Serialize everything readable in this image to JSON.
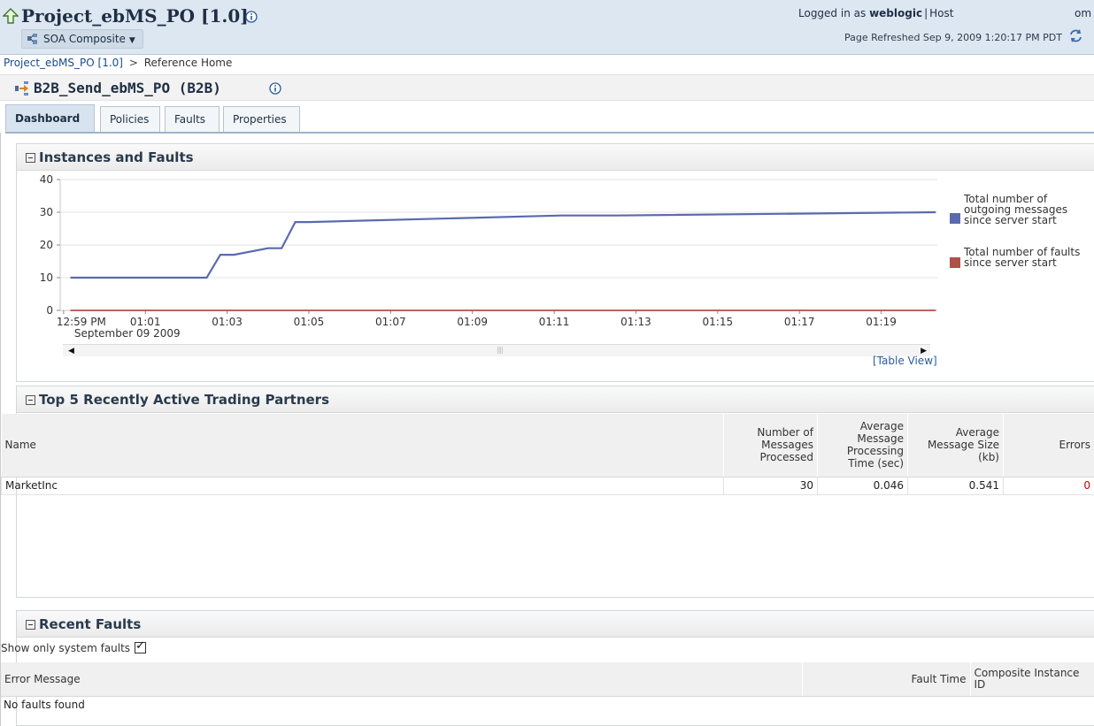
{
  "header": {
    "app_title": "Project_ebMS_PO [1.0]",
    "menu_label": "SOA Composite",
    "logged_in_prefix": "Logged in as",
    "user": "weblogic",
    "separator": "|",
    "host_label": "Host",
    "host_value": "om",
    "refreshed": "Page Refreshed Sep 9, 2009 1:20:17 PM PDT"
  },
  "breadcrumb": {
    "link": "Project_ebMS_PO [1.0]",
    "separator": ">",
    "current": "Reference Home"
  },
  "page": {
    "title": "B2B_Send_ebMS_PO (B2B)"
  },
  "tabs": [
    {
      "label": "Dashboard",
      "active": true
    },
    {
      "label": "Policies",
      "active": false
    },
    {
      "label": "Faults",
      "active": false
    },
    {
      "label": "Properties",
      "active": false
    }
  ],
  "instances_panel": {
    "title": "Instances and Faults",
    "table_view_label": "[Table View]"
  },
  "chart_data": {
    "type": "line",
    "title": "",
    "xlabel": "",
    "ylabel": "",
    "ylim": [
      0,
      40
    ],
    "y_ticks": [
      0,
      10,
      20,
      30,
      40
    ],
    "x_tick_labels": [
      "12:59 PM",
      "01:01",
      "01:03",
      "01:05",
      "01:07",
      "01:09",
      "01:11",
      "01:13",
      "01:15",
      "01:17",
      "01:19"
    ],
    "x_sub_label": "September 09 2009",
    "grid": true,
    "legend_position": "right",
    "series": [
      {
        "name": "Total number of outgoing messages since server start",
        "color": "#5a6aae",
        "x": [
          "12:59:10",
          "01:02:30",
          "01:02:50",
          "01:03:10",
          "01:04:00",
          "01:04:20",
          "01:04:40",
          "01:05:00",
          "01:11:10",
          "01:12:30",
          "01:20:20"
        ],
        "values": [
          10,
          10,
          17,
          17,
          19,
          19,
          27,
          27,
          29,
          29,
          30
        ]
      },
      {
        "name": "Total number of faults since server start",
        "color": "#b0504a",
        "x": [
          "12:59:10",
          "01:20:20"
        ],
        "values": [
          0,
          0
        ]
      }
    ]
  },
  "partners_panel": {
    "title": "Top 5 Recently Active Trading Partners",
    "columns": [
      "Name",
      "Number of Messages Processed",
      "Average Message Processing Time (sec)",
      "Average Message Size (kb)",
      "Errors"
    ],
    "rows": [
      {
        "name": "MarketInc",
        "messages": "30",
        "avg_time": "0.046",
        "avg_size": "0.541",
        "errors": "0"
      }
    ]
  },
  "faults_panel": {
    "title": "Recent Faults",
    "show_system_label": "Show only system faults",
    "show_system_checked": true,
    "columns": [
      "Error Message",
      "Fault Time",
      "Composite Instance ID"
    ],
    "empty_text": "No faults found"
  }
}
